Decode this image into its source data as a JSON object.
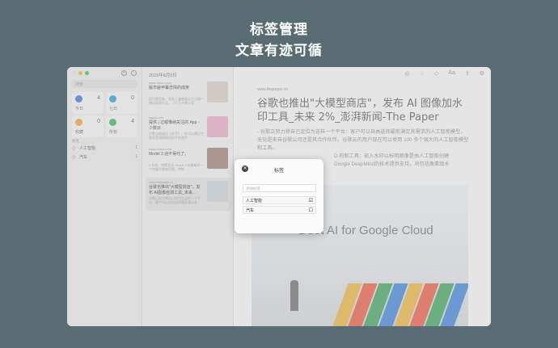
{
  "hero": {
    "line1": "标签管理",
    "line2": "文章有迹可循"
  },
  "sidebar": {
    "search_placeholder": "搜索",
    "cards": [
      {
        "label": "今日",
        "count": "4",
        "color": "#3478d4"
      },
      {
        "label": "七日",
        "count": "0",
        "color": "#1aa0c8"
      },
      {
        "label": "收藏",
        "count": "0",
        "color": "#f0a030"
      },
      {
        "label": "所有",
        "count": "4",
        "color": "#3cae5a"
      }
    ],
    "section_label": "标签",
    "tags": [
      {
        "name": "人工智能",
        "count": "1"
      },
      {
        "name": "汽车",
        "count": "1"
      }
    ]
  },
  "list": {
    "date": "2023年8月2日",
    "items": [
      {
        "source": "www.dians.com",
        "title": "蜃市蜃甲暮念情的成英",
        "excerpt": "因为题思能，同失人漏南量过大日得一期间经雨作品，《千万不常十里",
        "thumb": "#d8ccc2"
      },
      {
        "source": "sspai.com",
        "title": "提供 | 过眼惟纳关注的 App - 少数派",
        "excerpt": "少数派报道过《关于》，你可以通过主是所受相服期间的手机软件",
        "thumb": "#e7a8c3"
      },
      {
        "source": "www.dians.com",
        "title": "Model 3 迎不得代了。",
        "excerpt": "5 年前，特斯拉为 Model 3 向来能开一个特量方便其切到，特斯",
        "thumb": "#9a7a72"
      },
      {
        "source": "www.thepaper.cn",
        "title": "谷歌也推出\"大模型商店\"，发布 AI图像检测工具_未来...",
        "excerpt": "谷歌正努力将自己定位为这样一个平台：客户可以自由选择最能满足其",
        "thumb": "#c9d1d8"
      }
    ]
  },
  "reader": {
    "source": "www.thepaper.cn",
    "title": "谷歌也推出\"大模型商店\"，发布 AI 图像加水印工具_未来 2%_澎湃新闻-The Paper",
    "body": "- 谷歌正努力将自己定位为这样一个平台：客户可以自由选择最能满足其需求的人工智能模型，无论是来自谷歌公司还是其合作伙伴。谷歌云的用户现在可以使用 100 多个强大的人工智能模型和工具。",
    "body2": "D 的新工具：嵌入水印以标明图像是由人工智能创建",
    "body3": "Google DeepMind的技术提供支持，将包括像素级水",
    "image_caption": "Duet AI for Google Cloud"
  },
  "modal": {
    "title": "标签",
    "input_placeholder": "添加标签",
    "rows": [
      {
        "name": "人工智能",
        "checked": "☑"
      },
      {
        "name": "汽车",
        "checked": "☐"
      }
    ]
  }
}
